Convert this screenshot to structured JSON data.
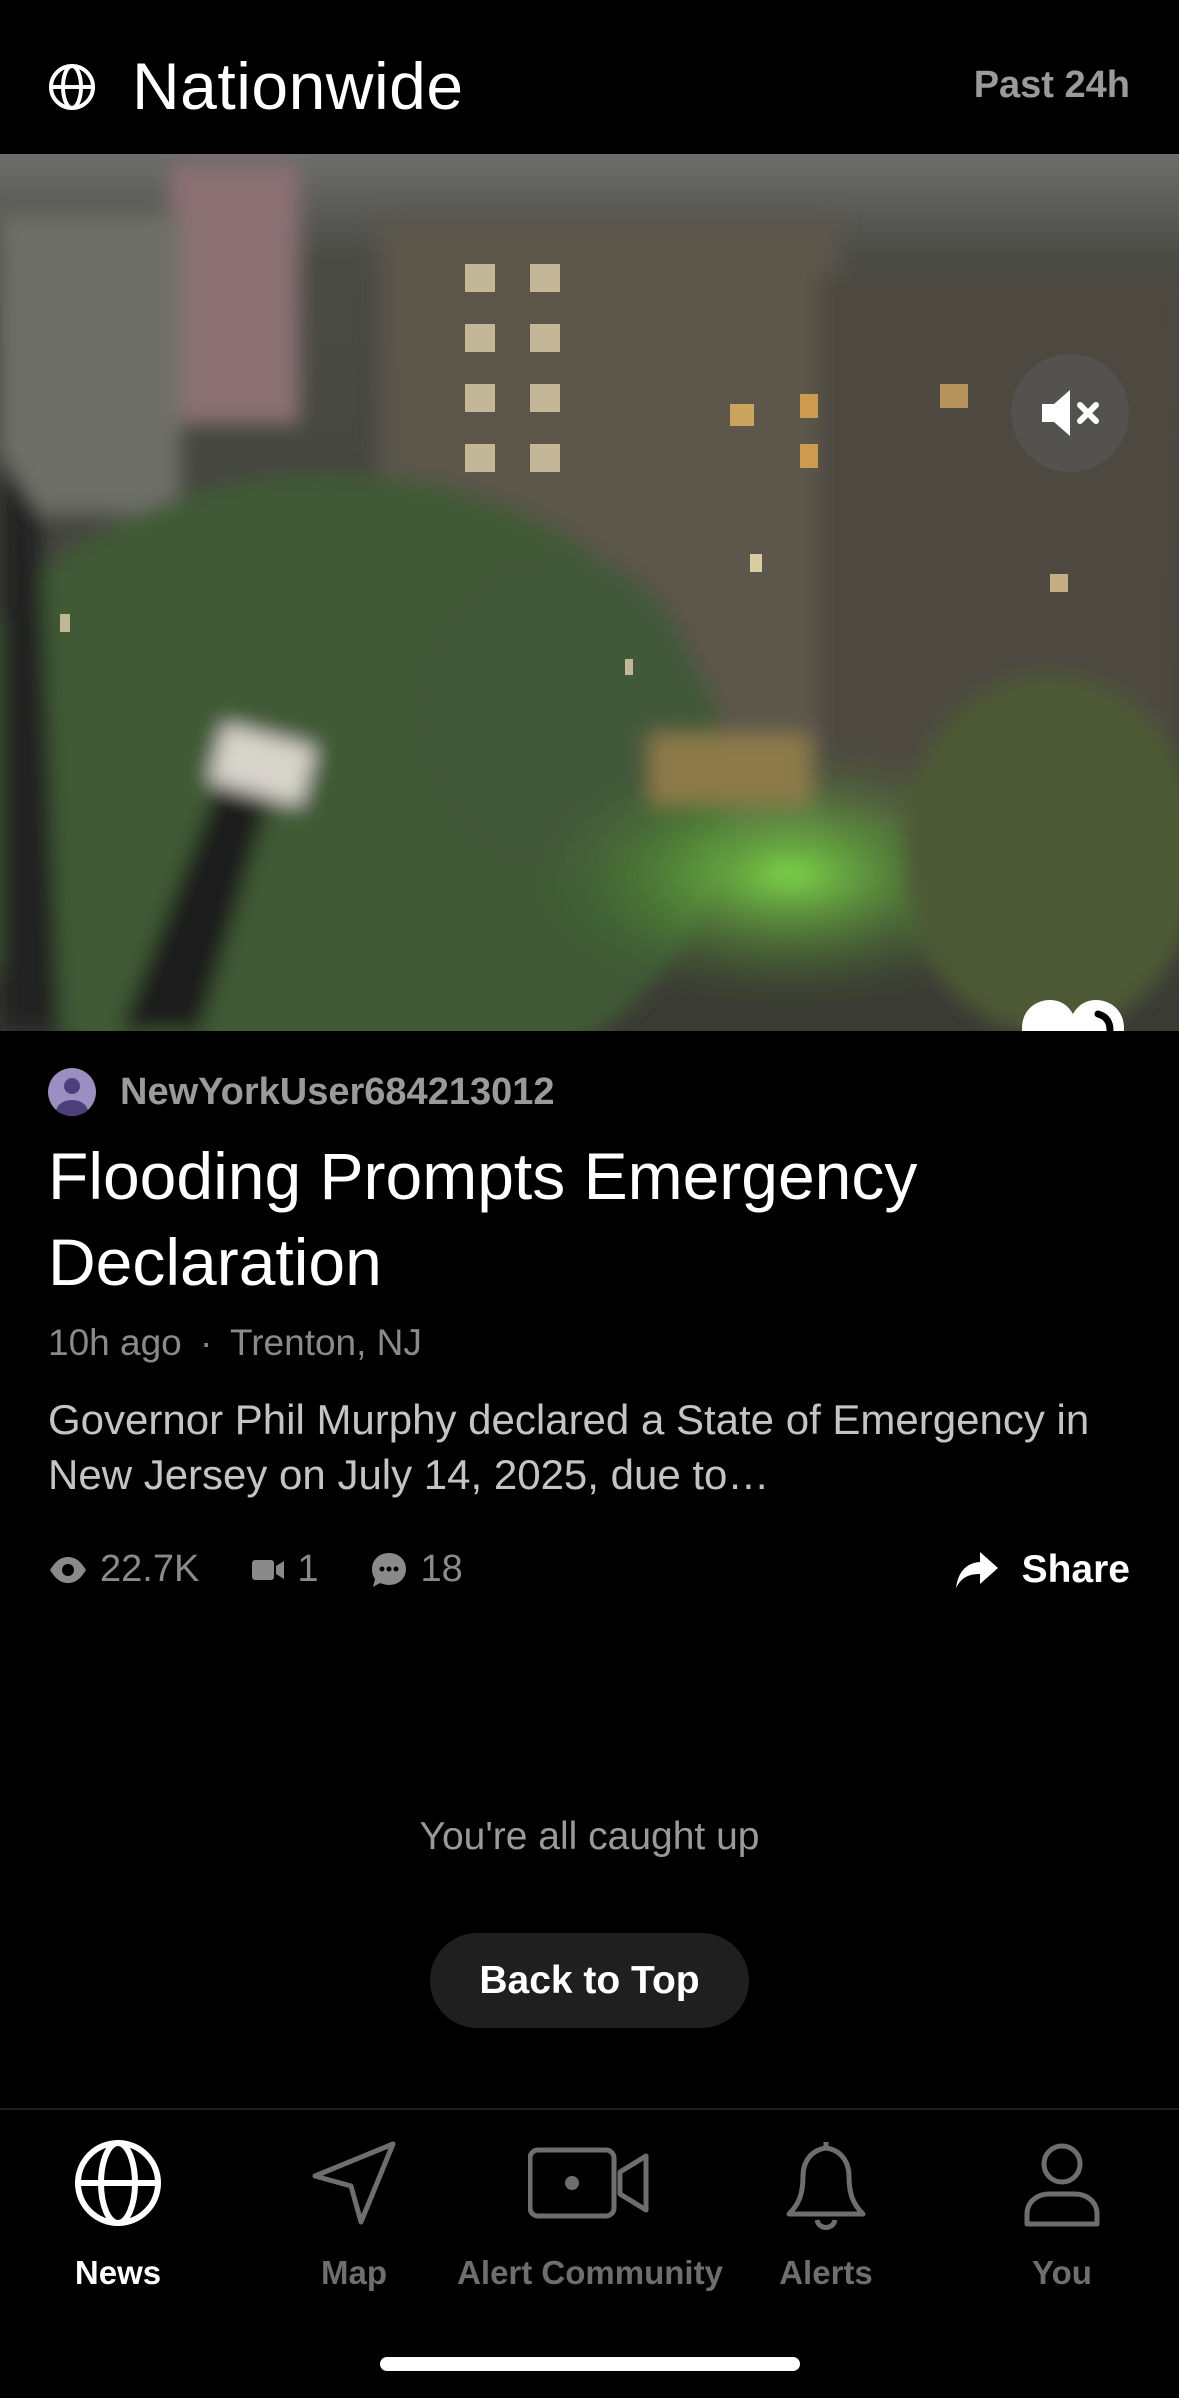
{
  "header": {
    "title": "Nationwide",
    "time_range": "Past 24h",
    "icon": "globe-icon"
  },
  "video": {
    "mute_icon": "speaker-muted-icon",
    "like_icon": "heart-icon"
  },
  "post": {
    "author": "NewYorkUser684213012",
    "title": "Flooding Prompts Emergency Declaration",
    "time": "10h ago",
    "separator": "·",
    "location": "Trenton, NJ",
    "summary": "Governor Phil Murphy declared a State of Emergency in New Jersey on July 14, 2025, due to…",
    "views": "22.7K",
    "videos": "1",
    "comments": "18",
    "share_label": "Share"
  },
  "feed_end": {
    "message": "You're all caught up",
    "back_to_top": "Back to Top"
  },
  "tabs": [
    {
      "label": "News",
      "icon": "globe-icon",
      "active": true
    },
    {
      "label": "Map",
      "icon": "navigation-arrow-icon",
      "active": false
    },
    {
      "label": "Alert Community",
      "icon": "video-camera-icon",
      "active": false
    },
    {
      "label": "Alerts",
      "icon": "bell-icon",
      "active": false
    },
    {
      "label": "You",
      "icon": "person-icon",
      "active": false
    }
  ],
  "colors": {
    "background": "#000000",
    "muted_text": "#9a9a9a",
    "button_bg": "#1f1f1f",
    "avatar": "#9b8ec0"
  }
}
